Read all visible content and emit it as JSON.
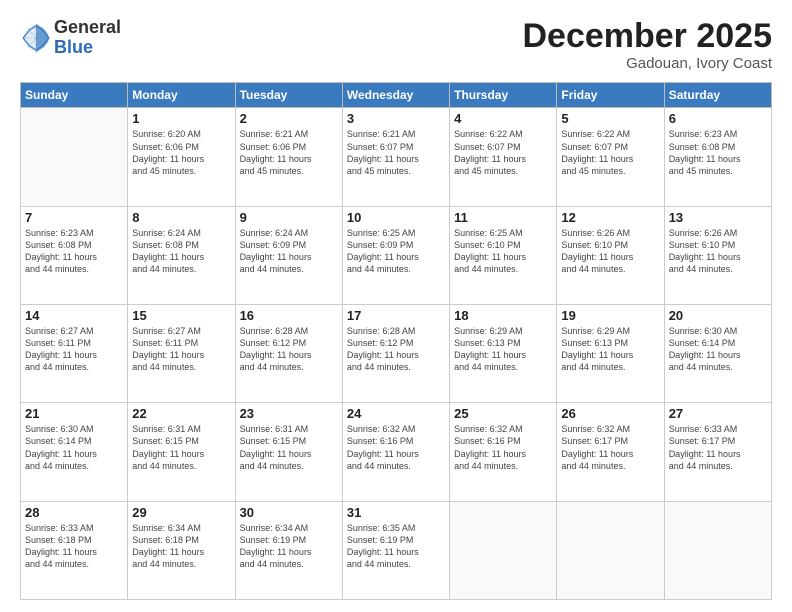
{
  "header": {
    "logo_general": "General",
    "logo_blue": "Blue",
    "month_title": "December 2025",
    "location": "Gadouan, Ivory Coast"
  },
  "days_of_week": [
    "Sunday",
    "Monday",
    "Tuesday",
    "Wednesday",
    "Thursday",
    "Friday",
    "Saturday"
  ],
  "weeks": [
    [
      {
        "day": "",
        "info": ""
      },
      {
        "day": "1",
        "info": "Sunrise: 6:20 AM\nSunset: 6:06 PM\nDaylight: 11 hours\nand 45 minutes."
      },
      {
        "day": "2",
        "info": "Sunrise: 6:21 AM\nSunset: 6:06 PM\nDaylight: 11 hours\nand 45 minutes."
      },
      {
        "day": "3",
        "info": "Sunrise: 6:21 AM\nSunset: 6:07 PM\nDaylight: 11 hours\nand 45 minutes."
      },
      {
        "day": "4",
        "info": "Sunrise: 6:22 AM\nSunset: 6:07 PM\nDaylight: 11 hours\nand 45 minutes."
      },
      {
        "day": "5",
        "info": "Sunrise: 6:22 AM\nSunset: 6:07 PM\nDaylight: 11 hours\nand 45 minutes."
      },
      {
        "day": "6",
        "info": "Sunrise: 6:23 AM\nSunset: 6:08 PM\nDaylight: 11 hours\nand 45 minutes."
      }
    ],
    [
      {
        "day": "7",
        "info": "Sunrise: 6:23 AM\nSunset: 6:08 PM\nDaylight: 11 hours\nand 44 minutes."
      },
      {
        "day": "8",
        "info": "Sunrise: 6:24 AM\nSunset: 6:08 PM\nDaylight: 11 hours\nand 44 minutes."
      },
      {
        "day": "9",
        "info": "Sunrise: 6:24 AM\nSunset: 6:09 PM\nDaylight: 11 hours\nand 44 minutes."
      },
      {
        "day": "10",
        "info": "Sunrise: 6:25 AM\nSunset: 6:09 PM\nDaylight: 11 hours\nand 44 minutes."
      },
      {
        "day": "11",
        "info": "Sunrise: 6:25 AM\nSunset: 6:10 PM\nDaylight: 11 hours\nand 44 minutes."
      },
      {
        "day": "12",
        "info": "Sunrise: 6:26 AM\nSunset: 6:10 PM\nDaylight: 11 hours\nand 44 minutes."
      },
      {
        "day": "13",
        "info": "Sunrise: 6:26 AM\nSunset: 6:10 PM\nDaylight: 11 hours\nand 44 minutes."
      }
    ],
    [
      {
        "day": "14",
        "info": "Sunrise: 6:27 AM\nSunset: 6:11 PM\nDaylight: 11 hours\nand 44 minutes."
      },
      {
        "day": "15",
        "info": "Sunrise: 6:27 AM\nSunset: 6:11 PM\nDaylight: 11 hours\nand 44 minutes."
      },
      {
        "day": "16",
        "info": "Sunrise: 6:28 AM\nSunset: 6:12 PM\nDaylight: 11 hours\nand 44 minutes."
      },
      {
        "day": "17",
        "info": "Sunrise: 6:28 AM\nSunset: 6:12 PM\nDaylight: 11 hours\nand 44 minutes."
      },
      {
        "day": "18",
        "info": "Sunrise: 6:29 AM\nSunset: 6:13 PM\nDaylight: 11 hours\nand 44 minutes."
      },
      {
        "day": "19",
        "info": "Sunrise: 6:29 AM\nSunset: 6:13 PM\nDaylight: 11 hours\nand 44 minutes."
      },
      {
        "day": "20",
        "info": "Sunrise: 6:30 AM\nSunset: 6:14 PM\nDaylight: 11 hours\nand 44 minutes."
      }
    ],
    [
      {
        "day": "21",
        "info": "Sunrise: 6:30 AM\nSunset: 6:14 PM\nDaylight: 11 hours\nand 44 minutes."
      },
      {
        "day": "22",
        "info": "Sunrise: 6:31 AM\nSunset: 6:15 PM\nDaylight: 11 hours\nand 44 minutes."
      },
      {
        "day": "23",
        "info": "Sunrise: 6:31 AM\nSunset: 6:15 PM\nDaylight: 11 hours\nand 44 minutes."
      },
      {
        "day": "24",
        "info": "Sunrise: 6:32 AM\nSunset: 6:16 PM\nDaylight: 11 hours\nand 44 minutes."
      },
      {
        "day": "25",
        "info": "Sunrise: 6:32 AM\nSunset: 6:16 PM\nDaylight: 11 hours\nand 44 minutes."
      },
      {
        "day": "26",
        "info": "Sunrise: 6:32 AM\nSunset: 6:17 PM\nDaylight: 11 hours\nand 44 minutes."
      },
      {
        "day": "27",
        "info": "Sunrise: 6:33 AM\nSunset: 6:17 PM\nDaylight: 11 hours\nand 44 minutes."
      }
    ],
    [
      {
        "day": "28",
        "info": "Sunrise: 6:33 AM\nSunset: 6:18 PM\nDaylight: 11 hours\nand 44 minutes."
      },
      {
        "day": "29",
        "info": "Sunrise: 6:34 AM\nSunset: 6:18 PM\nDaylight: 11 hours\nand 44 minutes."
      },
      {
        "day": "30",
        "info": "Sunrise: 6:34 AM\nSunset: 6:19 PM\nDaylight: 11 hours\nand 44 minutes."
      },
      {
        "day": "31",
        "info": "Sunrise: 6:35 AM\nSunset: 6:19 PM\nDaylight: 11 hours\nand 44 minutes."
      },
      {
        "day": "",
        "info": ""
      },
      {
        "day": "",
        "info": ""
      },
      {
        "day": "",
        "info": ""
      }
    ]
  ]
}
